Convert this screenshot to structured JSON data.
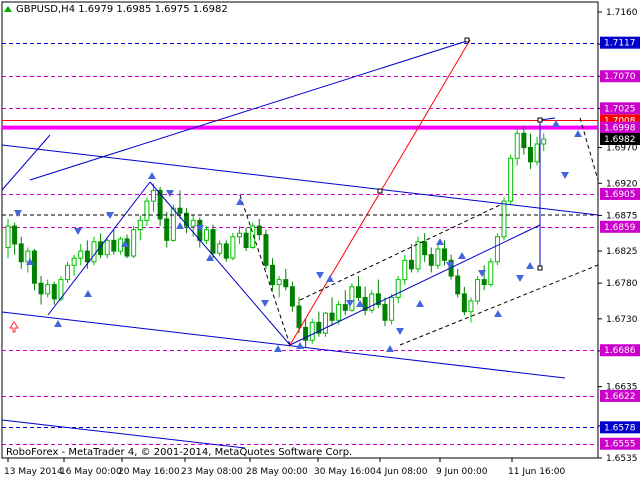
{
  "window": {
    "symbol_info": "GBPUSD,H4  1.6979 1.6985 1.6975 1.6982",
    "footer": "RoboForex - MetaTrader 4, © 2001-2014, MetaQuotes Software Corp."
  },
  "colors": {
    "background": "#ffffff",
    "candle_up": "#00c000",
    "candle_down": "#008000",
    "candle_up_body": "#ffffff",
    "trend_line": "#0000cc",
    "target_line": "#ff0000",
    "price_level": "#cc00cc",
    "resistance": "#ff00ff",
    "resistance_red": "#ff0000",
    "arrow": "#4466dd",
    "current_price_box": "#000000",
    "level_box_blue": "#0000cc"
  },
  "chart_data": {
    "type": "candlestick",
    "symbol": "GBPUSD",
    "timeframe": "H4",
    "ohlc_current": {
      "open": 1.6979,
      "high": 1.6985,
      "low": 1.6975,
      "close": 1.6982
    },
    "ylim": [
      1.6535,
      1.716
    ],
    "y_ticks": [
      "1.7160",
      "1.7115",
      "1.7070",
      "1.7025",
      "1.6970",
      "1.6920",
      "1.6875",
      "1.6825",
      "1.6780",
      "1.6730",
      "1.6685",
      "1.6635",
      "1.6580",
      "1.6535"
    ],
    "x_ticks": [
      "13 May 2014",
      "16 May 00:00",
      "20 May 16:00",
      "23 May 08:00",
      "28 May 00:00",
      "30 May 16:00",
      "4 Jun 08:00",
      "9 Jun 00:00",
      "11 Jun 16:00"
    ],
    "levels": [
      {
        "label": "1.7117",
        "value": 1.7117,
        "style": "box-blue"
      },
      {
        "label": "1.7070",
        "value": 1.707,
        "style": "box-magenta"
      },
      {
        "label": "1.7025",
        "value": 1.7025,
        "style": "box-magenta"
      },
      {
        "label": "1.7008",
        "value": 1.7008,
        "style": "box-red"
      },
      {
        "label": "1.6998",
        "value": 1.6998,
        "style": "box-magenta"
      },
      {
        "label": "1.6982",
        "value": 1.6982,
        "style": "box-black"
      },
      {
        "label": "1.6905",
        "value": 1.6905,
        "style": "box-magenta"
      },
      {
        "label": "1.6859",
        "value": 1.6859,
        "style": "box-magenta"
      },
      {
        "label": "1.6686",
        "value": 1.6686,
        "style": "box-magenta"
      },
      {
        "label": "1.6622",
        "value": 1.6622,
        "style": "box-magenta"
      },
      {
        "label": "1.6578",
        "value": 1.6578,
        "style": "box-blue"
      },
      {
        "label": "1.6555",
        "value": 1.6555,
        "style": "box-magenta"
      }
    ],
    "candles": [
      [
        1.683,
        1.687,
        1.6815,
        1.686
      ],
      [
        1.686,
        1.6865,
        1.682,
        1.6835
      ],
      [
        1.6835,
        1.6845,
        1.68,
        1.681
      ],
      [
        1.681,
        1.683,
        1.6795,
        1.6825
      ],
      [
        1.6825,
        1.6828,
        1.677,
        1.678
      ],
      [
        1.678,
        1.679,
        1.675,
        1.6765
      ],
      [
        1.6765,
        1.6785,
        1.676,
        1.6778
      ],
      [
        1.6778,
        1.6782,
        1.675,
        1.6758
      ],
      [
        1.6758,
        1.679,
        1.6755,
        1.6785
      ],
      [
        1.6785,
        1.681,
        1.678,
        1.6805
      ],
      [
        1.6805,
        1.682,
        1.679,
        1.6815
      ],
      [
        1.6815,
        1.6835,
        1.6805,
        1.6825
      ],
      [
        1.6825,
        1.684,
        1.68,
        1.681
      ],
      [
        1.681,
        1.6845,
        1.6805,
        1.6838
      ],
      [
        1.6838,
        1.685,
        1.6815,
        1.682
      ],
      [
        1.682,
        1.6845,
        1.6815,
        1.684
      ],
      [
        1.684,
        1.6855,
        1.682,
        1.6825
      ],
      [
        1.6825,
        1.6845,
        1.682,
        1.6842
      ],
      [
        1.6842,
        1.6848,
        1.6815,
        1.6818
      ],
      [
        1.6818,
        1.686,
        1.6815,
        1.6855
      ],
      [
        1.6855,
        1.6875,
        1.684,
        1.6868
      ],
      [
        1.6868,
        1.69,
        1.686,
        1.6895
      ],
      [
        1.6895,
        1.692,
        1.688,
        1.691
      ],
      [
        1.691,
        1.6915,
        1.686,
        1.687
      ],
      [
        1.687,
        1.688,
        1.683,
        1.684
      ],
      [
        1.684,
        1.689,
        1.6838,
        1.6885
      ],
      [
        1.6885,
        1.691,
        1.687,
        1.6878
      ],
      [
        1.6878,
        1.6885,
        1.685,
        1.686
      ],
      [
        1.686,
        1.6875,
        1.6845,
        1.6868
      ],
      [
        1.6868,
        1.6872,
        1.683,
        1.684
      ],
      [
        1.684,
        1.686,
        1.6835,
        1.6855
      ],
      [
        1.6855,
        1.6862,
        1.6815,
        1.6822
      ],
      [
        1.6822,
        1.684,
        1.6818,
        1.6835
      ],
      [
        1.6835,
        1.684,
        1.681,
        1.6815
      ],
      [
        1.6815,
        1.685,
        1.6812,
        1.6845
      ],
      [
        1.6845,
        1.686,
        1.6835,
        1.685
      ],
      [
        1.685,
        1.6858,
        1.6825,
        1.683
      ],
      [
        1.683,
        1.6865,
        1.6828,
        1.686
      ],
      [
        1.686,
        1.687,
        1.684,
        1.6848
      ],
      [
        1.6848,
        1.6855,
        1.68,
        1.6805
      ],
      [
        1.6805,
        1.6815,
        1.677,
        1.6778
      ],
      [
        1.6778,
        1.679,
        1.676,
        1.6785
      ],
      [
        1.6785,
        1.68,
        1.677,
        1.6775
      ],
      [
        1.6775,
        1.6782,
        1.674,
        1.6748
      ],
      [
        1.6748,
        1.676,
        1.671,
        1.6718
      ],
      [
        1.6718,
        1.673,
        1.669,
        1.67
      ],
      [
        1.67,
        1.673,
        1.6695,
        1.6725
      ],
      [
        1.6725,
        1.674,
        1.6705,
        1.671
      ],
      [
        1.671,
        1.674,
        1.6705,
        1.6738
      ],
      [
        1.6738,
        1.676,
        1.672,
        1.6728
      ],
      [
        1.6728,
        1.6755,
        1.6722,
        1.675
      ],
      [
        1.675,
        1.677,
        1.6735,
        1.6742
      ],
      [
        1.6742,
        1.678,
        1.674,
        1.6775
      ],
      [
        1.6775,
        1.679,
        1.6755,
        1.676
      ],
      [
        1.676,
        1.6775,
        1.6735,
        1.6742
      ],
      [
        1.6742,
        1.677,
        1.6738,
        1.6765
      ],
      [
        1.6765,
        1.6785,
        1.6745,
        1.675
      ],
      [
        1.675,
        1.676,
        1.672,
        1.6728
      ],
      [
        1.6728,
        1.6765,
        1.6722,
        1.676
      ],
      [
        1.676,
        1.679,
        1.6752,
        1.6785
      ],
      [
        1.6785,
        1.682,
        1.6778,
        1.6812
      ],
      [
        1.6812,
        1.6835,
        1.6795,
        1.68
      ],
      [
        1.68,
        1.6845,
        1.6795,
        1.6838
      ],
      [
        1.6838,
        1.685,
        1.681,
        1.682
      ],
      [
        1.682,
        1.683,
        1.6795,
        1.6805
      ],
      [
        1.6805,
        1.6835,
        1.68,
        1.6828
      ],
      [
        1.6828,
        1.684,
        1.6805,
        1.6812
      ],
      [
        1.6812,
        1.682,
        1.6785,
        1.679
      ],
      [
        1.679,
        1.68,
        1.676,
        1.6765
      ],
      [
        1.6765,
        1.6775,
        1.6735,
        1.674
      ],
      [
        1.674,
        1.676,
        1.6725,
        1.6755
      ],
      [
        1.6755,
        1.679,
        1.675,
        1.6785
      ],
      [
        1.6785,
        1.6805,
        1.677,
        1.6778
      ],
      [
        1.6778,
        1.6815,
        1.6775,
        1.681
      ],
      [
        1.681,
        1.685,
        1.6805,
        1.6845
      ],
      [
        1.6845,
        1.69,
        1.684,
        1.6895
      ],
      [
        1.6895,
        1.696,
        1.689,
        1.6955
      ],
      [
        1.6955,
        1.6998,
        1.6945,
        1.699
      ],
      [
        1.699,
        1.7,
        1.696,
        1.697
      ],
      [
        1.697,
        1.699,
        1.694,
        1.695
      ],
      [
        1.695,
        1.6985,
        1.6945,
        1.6975
      ],
      [
        1.6975,
        1.699,
        1.6965,
        1.6982
      ]
    ]
  }
}
